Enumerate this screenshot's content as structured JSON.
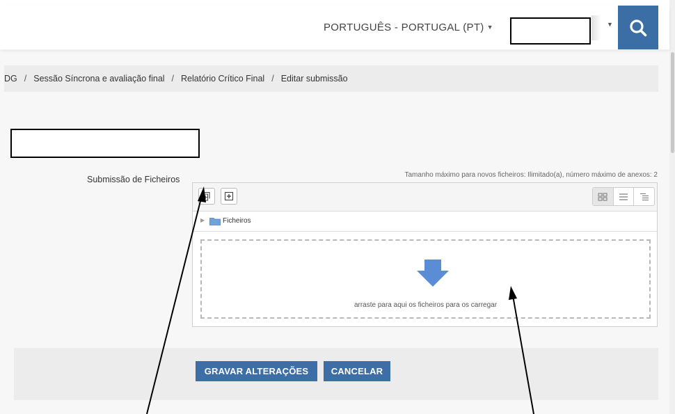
{
  "header": {
    "language_label": "PORTUGUÊS - PORTUGAL (PT)",
    "search_icon": "search-icon"
  },
  "breadcrumb": {
    "items": [
      "DG",
      "Sessão Síncrona e avaliação final",
      "Relatório Crítico Final",
      "Editar submissão"
    ]
  },
  "form": {
    "field_label": "Submissão de Ficheiros",
    "max_info": "Tamanho máximo para novos ficheiros: Ilimitado(a), número máximo de anexos: 2"
  },
  "filemanager": {
    "toolbar_icons": [
      "add-file-icon",
      "create-folder-icon"
    ],
    "view_icons": [
      "grid-view-icon",
      "list-view-icon",
      "tree-view-icon"
    ],
    "path_label": "Ficheiros",
    "drop_text": "arraste para aqui os ficheiros para os carregar"
  },
  "buttons": {
    "save_label": "GRAVAR ALTERAÇÕES",
    "cancel_label": "CANCELAR"
  },
  "colors": {
    "primary": "#3a6ea5",
    "panel": "#ececec",
    "arrow": "#5b8dd6"
  }
}
